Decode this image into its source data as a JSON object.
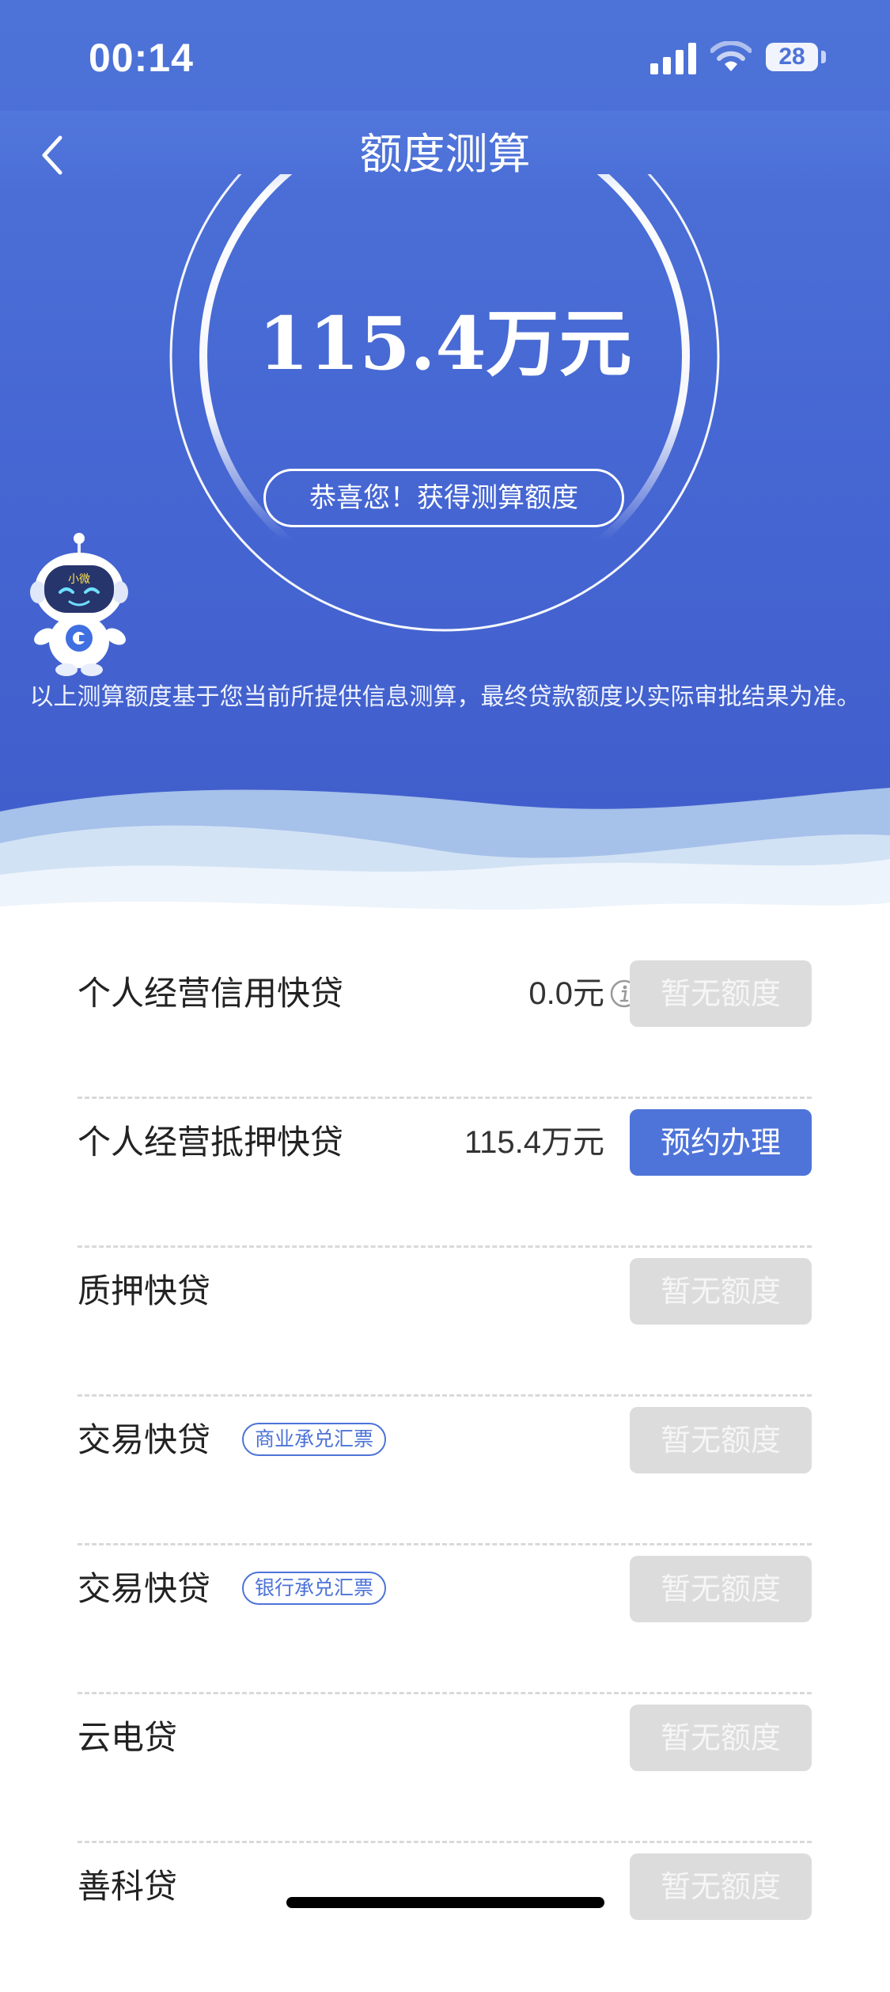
{
  "status_bar": {
    "time": "00:14",
    "battery": "28"
  },
  "nav": {
    "title": "额度测算"
  },
  "result": {
    "amount": "115.4万元",
    "congrats": "恭喜您！获得测算额度",
    "mascot_badge": "小微",
    "disclaimer": "以上测算额度基于您当前所提供信息测算，最终贷款额度以实际审批结果为准。"
  },
  "products": [
    {
      "name": "个人经营信用快贷",
      "tag": "",
      "value": "0.0元",
      "has_info": true,
      "button": "暂无额度",
      "button_state": "disabled"
    },
    {
      "name": "个人经营抵押快贷",
      "tag": "",
      "value": "115.4万元",
      "has_info": false,
      "button": "预约办理",
      "button_state": "active"
    },
    {
      "name": "质押快贷",
      "tag": "",
      "value": "",
      "has_info": false,
      "button": "暂无额度",
      "button_state": "disabled"
    },
    {
      "name": "交易快贷",
      "tag": "商业承兑汇票",
      "value": "",
      "has_info": false,
      "button": "暂无额度",
      "button_state": "disabled"
    },
    {
      "name": "交易快贷",
      "tag": "银行承兑汇票",
      "value": "",
      "has_info": false,
      "button": "暂无额度",
      "button_state": "disabled"
    },
    {
      "name": "云电贷",
      "tag": "",
      "value": "",
      "has_info": false,
      "button": "暂无额度",
      "button_state": "disabled"
    },
    {
      "name": "善科贷",
      "tag": "",
      "value": "",
      "has_info": false,
      "button": "暂无额度",
      "button_state": "disabled"
    }
  ],
  "colors": {
    "accent": "#4f74d9",
    "hero_top": "#4d73d8",
    "hero_bottom": "#3f5cc9",
    "disabled": "#dcdcdc"
  }
}
